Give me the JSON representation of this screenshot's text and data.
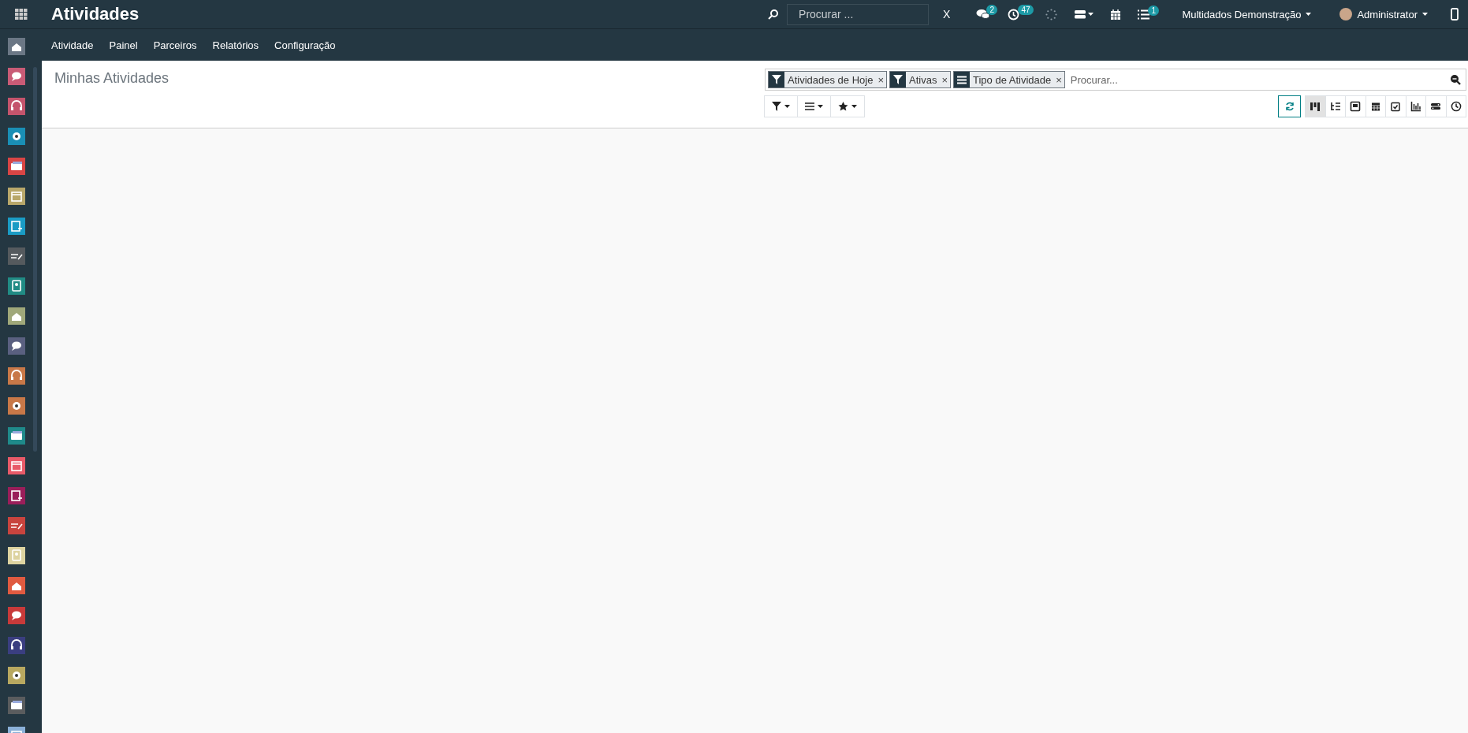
{
  "app_title": "Atividades",
  "topbar": {
    "search": {
      "placeholder": "Procurar ..."
    },
    "clear_label": "X",
    "messages_badge": "2",
    "activities_badge": "47",
    "tasks_badge": "1",
    "company": "Multidados Demonstração",
    "user": "Administrator"
  },
  "menu": [
    "Atividade",
    "Painel",
    "Parceiros",
    "Relatórios",
    "Configuração"
  ],
  "sidebar": {
    "apps": [
      {
        "color": "#6b7785"
      },
      {
        "color": "#c95b76"
      },
      {
        "color": "#c4546c"
      },
      {
        "color": "#1a8fb5"
      },
      {
        "color": "#d84545"
      },
      {
        "color": "#b8a76a"
      },
      {
        "color": "#1a9bc4"
      },
      {
        "color": "#555a5e"
      },
      {
        "color": "#218b84"
      },
      {
        "color": "#a0a87a"
      },
      {
        "color": "#5a6080"
      },
      {
        "color": "#c87848"
      },
      {
        "color": "#c87848"
      },
      {
        "color": "#1f8a8a"
      },
      {
        "color": "#e85a68"
      },
      {
        "color": "#9a1e5a"
      },
      {
        "color": "#c8443e"
      },
      {
        "color": "#ddd3a0"
      },
      {
        "color": "#e05a40"
      },
      {
        "color": "#c83a3a"
      },
      {
        "color": "#3a3e80"
      },
      {
        "color": "#b8a860"
      },
      {
        "color": "#5a5c5e"
      },
      {
        "color": "#8ab0d8"
      }
    ]
  },
  "breadcrumb": "Minhas Atividades",
  "facets": [
    {
      "kind": "filter",
      "label": "Atividades de Hoje",
      "remove": "×"
    },
    {
      "kind": "filter",
      "label": "Ativas",
      "remove": "×"
    },
    {
      "kind": "group",
      "label": "Tipo de Atividade",
      "remove": "×"
    }
  ],
  "search": {
    "placeholder": "Procurar..."
  },
  "views": [
    {
      "kind": "kanban",
      "selected": true
    },
    {
      "kind": "list",
      "selected": false
    },
    {
      "kind": "form",
      "selected": false
    },
    {
      "kind": "calendar",
      "selected": false
    },
    {
      "kind": "activity",
      "selected": false
    },
    {
      "kind": "graph",
      "selected": false
    },
    {
      "kind": "pivot",
      "selected": false
    },
    {
      "kind": "clock",
      "selected": false
    }
  ]
}
